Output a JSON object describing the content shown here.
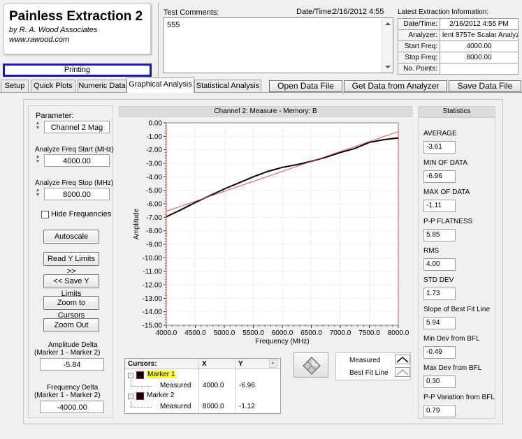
{
  "app": {
    "title": "Painless Extraction 2",
    "author": "by R. A. Wood Associates",
    "website": "www.rawood.com",
    "status": "Printing"
  },
  "comments": {
    "label": "Test Comments:",
    "datetime_label": "Date/Time:",
    "datetime_value": "2/16/2012  4:55",
    "text": "555"
  },
  "latest": {
    "title": "Latest Extraction Information:",
    "rows": [
      {
        "label": "Date/Time:",
        "value": "2/16/2012  4:55 PM"
      },
      {
        "label": "Analyzer:",
        "value": "lent 8757e Scalar Analyz"
      },
      {
        "label": "Start Freq:",
        "value": "4000.00"
      },
      {
        "label": "Stop Freq:",
        "value": "8000.00"
      },
      {
        "label": "No. Points:",
        "value": ""
      }
    ]
  },
  "tabs": [
    "Setup",
    "Quick Plots",
    "Numeric Data",
    "Graphical Analysis",
    "Statistical Analysis"
  ],
  "actions": {
    "open": "Open Data File",
    "get": "Get Data from Analyzer",
    "save": "Save Data File"
  },
  "left": {
    "parameter_label": "Parameter:",
    "parameter_value": "Channel 2 Mag",
    "start_label": "Analyze Freq Start (MHz)",
    "start_value": "4000.00",
    "stop_label": "Analyze Freq Stop (MHz)",
    "stop_value": "8000.00",
    "hide_label": "Hide Frequencies",
    "autoscale": "Autoscale",
    "read_y": "Read Y Limits >>",
    "save_y": "<< Save Y Limits",
    "zoom_cursors": "Zoom to Cursors",
    "zoom_out": "Zoom Out",
    "amp_delta_label1": "Amplitude Delta",
    "amp_delta_label2": "(Marker 1 - Marker 2)",
    "amp_delta_value": "-5.84",
    "freq_delta_label1": "Frequency Delta",
    "freq_delta_label2": "(Marker 1 - Marker 2)",
    "freq_delta_value": "-4000.00"
  },
  "chart_header": "Channel 2: Measure - Memory: B",
  "chart_data": {
    "type": "line",
    "xlabel": "Frequency (MHz)",
    "ylabel": "Amplitude",
    "xlim": [
      4000,
      8000
    ],
    "ylim": [
      -15,
      0
    ],
    "x_ticks": [
      "4000.0",
      "4500.0",
      "5000.0",
      "5500.0",
      "6000.0",
      "6500.0",
      "7000.0",
      "7500.0",
      "8000.0"
    ],
    "y_ticks": [
      "0.00",
      "-1.00",
      "-2.00",
      "-3.00",
      "-4.00",
      "-5.00",
      "-6.00",
      "-7.00",
      "-8.00",
      "-9.00",
      "-10.00",
      "-11.00",
      "-12.00",
      "-13.00",
      "-14.00",
      "-15.00"
    ],
    "grid": true,
    "series": [
      {
        "name": "Measured",
        "color": "#000000",
        "x": [
          4000,
          4250,
          4500,
          4750,
          5000,
          5250,
          5500,
          5750,
          6000,
          6250,
          6500,
          6750,
          7000,
          7250,
          7500,
          7750,
          8000
        ],
        "y": [
          -6.96,
          -6.45,
          -5.9,
          -5.4,
          -4.9,
          -4.45,
          -4.0,
          -3.6,
          -3.3,
          -3.1,
          -2.85,
          -2.55,
          -2.2,
          -1.9,
          -1.45,
          -1.25,
          -1.12
        ]
      },
      {
        "name": "Best Fit Line",
        "color": "#e05050",
        "x": [
          4000,
          8000
        ],
        "y": [
          -6.55,
          -0.65
        ]
      }
    ]
  },
  "cursors": {
    "headers": [
      "Cursors:",
      "X",
      "Y"
    ],
    "markers": [
      {
        "name": "Marker 1",
        "child": "Measured",
        "x": "4000.0",
        "y": "-6.96"
      },
      {
        "name": "Marker 2",
        "child": "Measured",
        "x": "8000.0",
        "y": "-1.12"
      }
    ]
  },
  "legend": [
    {
      "name": "Measured",
      "color": "#000000"
    },
    {
      "name": "Best Fit Line",
      "color": "#e05050"
    }
  ],
  "stats": {
    "title": "Statistics",
    "items": [
      {
        "label": "AVERAGE",
        "value": "-3.61"
      },
      {
        "label": "MIN OF DATA",
        "value": "-6.96"
      },
      {
        "label": "MAX OF DATA",
        "value": "-1.11"
      },
      {
        "label": "P-P FLATNESS",
        "value": "5.85"
      },
      {
        "label": "RMS",
        "value": "4.00"
      },
      {
        "label": "STD DEV",
        "value": "1.73"
      },
      {
        "label": "Slope of Best Fit Line",
        "value": "5.94"
      },
      {
        "label": "Min Dev from BFL",
        "value": "-0.49"
      },
      {
        "label": "Max Dev from BFL",
        "value": "0.30"
      },
      {
        "label": "P-P Variation from BFL",
        "value": "0.79"
      }
    ]
  }
}
